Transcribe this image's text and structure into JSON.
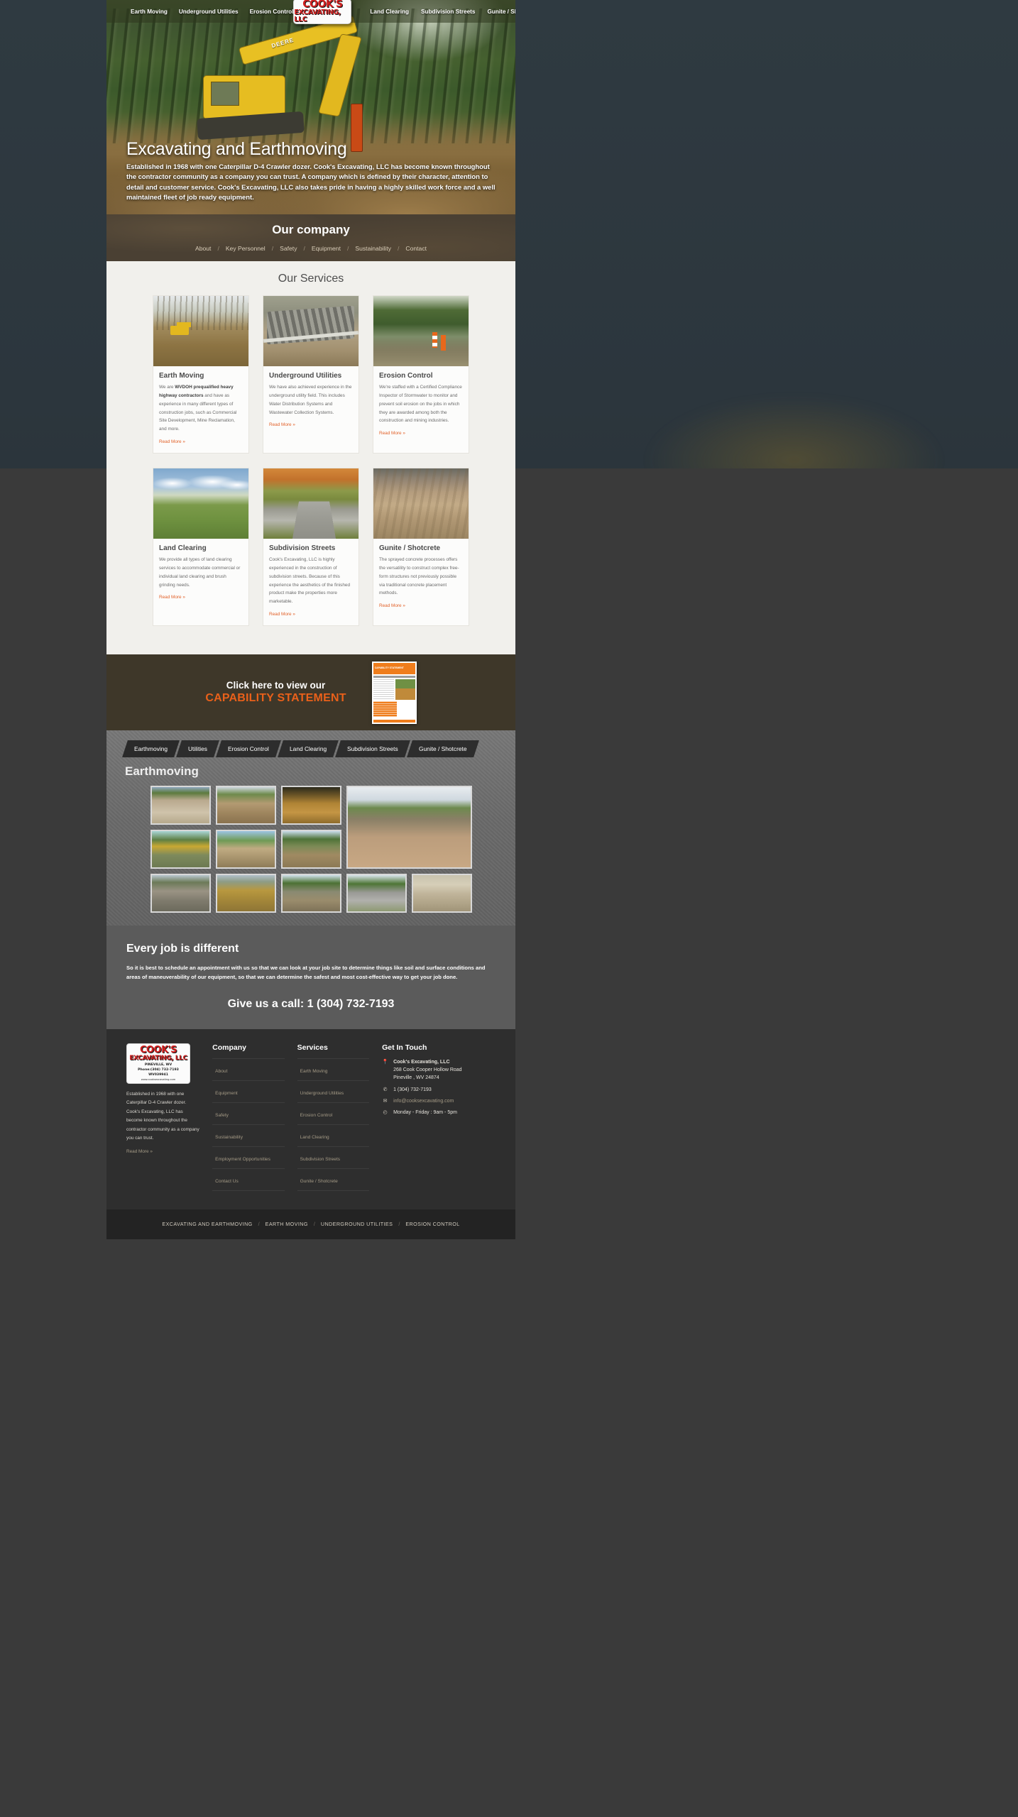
{
  "brand": {
    "logo_line1": "COOK'S",
    "logo_line2": "EXCAVATING, LLC",
    "logo_city": "PINEVILLE,  WV",
    "logo_phone": "Phone:(304) 732-7193",
    "logo_license": "WV039941",
    "logo_url": "www.cooksexcavating.com"
  },
  "topnav": {
    "left": [
      {
        "label": "Earth Moving"
      },
      {
        "label": "Underground Utilities"
      },
      {
        "label": "Erosion Control"
      }
    ],
    "right": [
      {
        "label": "Land Clearing"
      },
      {
        "label": "Subdivision Streets"
      },
      {
        "label": "Gunite / Shotcrete"
      }
    ]
  },
  "hero": {
    "machine_label": "DEERE",
    "title": "Excavating and Earthmoving",
    "subtitle": "Established in 1968 with one Caterpillar D-4 Crawler dozer. Cook's Excavating, LLC has become known throughout the contractor community as a company you can trust. A company which is defined by their character, attention to detail and customer service. Cook's Excavating, LLC also takes pride in having a highly skilled work force and a well maintained fleet of job ready equipment."
  },
  "company": {
    "title": "Our company",
    "separator": "/",
    "links": [
      {
        "label": "About"
      },
      {
        "label": "Key Personnel"
      },
      {
        "label": "Safety"
      },
      {
        "label": "Equipment"
      },
      {
        "label": "Sustainability"
      },
      {
        "label": "Contact"
      }
    ]
  },
  "services": {
    "title": "Our Services",
    "read_more": "Read More »",
    "cards": [
      {
        "name": "Earth Moving",
        "desc_bold": "WVDOH prequalified heavy highway contractors",
        "desc_pre": "We are ",
        "desc_post": " and have as experience in many different types of construction jobs, such as Commercial Site Development, Mine Reclamation, and more."
      },
      {
        "name": "Underground Utilities",
        "desc_pre": "We have also achieved experience in the underground utility field. This includes Water Distribution Systems and Wastewater Collection Systems.",
        "desc_bold": "",
        "desc_post": ""
      },
      {
        "name": "Erosion Control",
        "desc_pre": "We're staffed with a Certified Compliance Inspector of Stormwater to monitor and prevent soil erosion on the jobs in which they are awarded among both the construction and mining industries.",
        "desc_bold": "",
        "desc_post": ""
      },
      {
        "name": "Land Clearing",
        "desc_pre": "We provide all types of land clearing services to accommodate commercial or individual land clearing and brush grinding needs.",
        "desc_bold": "",
        "desc_post": ""
      },
      {
        "name": "Subdivision Streets",
        "desc_pre": "Cook's Excavating, LLC is highly experienced in the construction of subdivision streets. Because of this experience the aesthetics of the finished product make the properties more marketable.",
        "desc_bold": "",
        "desc_post": ""
      },
      {
        "name": "Gunite / Shotcrete",
        "desc_pre": "The sprayed concrete processes offers the versatility to construct complex free-form structures not previously possible via traditional concrete placement methods.",
        "desc_bold": "",
        "desc_post": ""
      }
    ]
  },
  "capability": {
    "line1": "Click here to view our",
    "line2": "CAPABILITY STATEMENT",
    "thumb_title": "CAPABILITY STATEMENT",
    "thumb_company": "Cook's Excavating, LLC"
  },
  "gallery": {
    "tabs": [
      {
        "label": "Earthmoving",
        "active": true
      },
      {
        "label": "Utilities",
        "active": false
      },
      {
        "label": "Erosion Control",
        "active": false
      },
      {
        "label": "Land Clearing",
        "active": false
      },
      {
        "label": "Subdivision Streets",
        "active": false
      },
      {
        "label": "Gunite / Shotcrete",
        "active": false
      }
    ],
    "heading": "Earthmoving"
  },
  "everyjob": {
    "title": "Every job is different",
    "body": "So it is best to schedule an appointment with us so that we can look at your job site to determine things like soil and surface conditions and areas of maneuverability of our equipment, so that we can determine the safest and most cost-effective way to get your job done.",
    "call": "Give us a call: 1 (304) 732-7193"
  },
  "footer": {
    "about": "Established in 1968 with one Caterpillar D-4 Crawler dozer. Cook's Excavating, LLC has become known throughout the contractor community as a company you can trust.",
    "read_more": "Read More »",
    "company": {
      "title": "Company",
      "links": [
        {
          "label": "About"
        },
        {
          "label": "Equipment"
        },
        {
          "label": "Safety"
        },
        {
          "label": "Sustainability"
        },
        {
          "label": "Employment Opportunities"
        },
        {
          "label": "Contact Us"
        }
      ]
    },
    "services": {
      "title": "Services",
      "links": [
        {
          "label": "Earth Moving"
        },
        {
          "label": "Underground Utilities"
        },
        {
          "label": "Erosion Control"
        },
        {
          "label": "Land Clearing"
        },
        {
          "label": "Subdivision Streets"
        },
        {
          "label": "Gunite / Shotcrete"
        }
      ]
    },
    "contact": {
      "title": "Get In Touch",
      "company_name": "Cook's Excavating, LLC",
      "address_line1": "268 Cook Cooper Hollow Road",
      "address_line2": "Pineville , WV 24874",
      "phone": "1 (304) 732-7193",
      "email": "info@cooksexcavating.com",
      "hours": "Monday - Friday : 9am - 5pm",
      "icons": {
        "location": "📍",
        "phone": "✆",
        "email": "✉",
        "clock": "◴"
      }
    }
  },
  "bottombar": {
    "separator": "/",
    "links": [
      {
        "label": "EXCAVATING AND EARTHMOVING"
      },
      {
        "label": "EARTH MOVING"
      },
      {
        "label": "UNDERGROUND UTILITIES"
      },
      {
        "label": "EROSION CONTROL"
      }
    ]
  },
  "colors": {
    "accent_orange": "#e2622a",
    "brand_red": "#d11f1f",
    "capability_orange": "#e9601a",
    "footer_link": "#a59b86"
  }
}
